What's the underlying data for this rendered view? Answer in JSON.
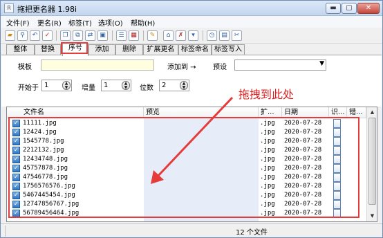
{
  "window": {
    "title": "拖把更名器 1.98i",
    "icon_glyph": "R",
    "controls": {
      "min": "▬",
      "max": "▢",
      "close": "✕"
    }
  },
  "menu": [
    "文件(F)",
    "更名(R)",
    "标签(T)",
    "选项(O)",
    "帮助(H)"
  ],
  "toolbar_icons": [
    "folder-open-icon",
    "search-icon",
    "undo-icon",
    "check-icon",
    "copy-icon",
    "paste-icon",
    "move-icon",
    "frame-icon",
    "list-icon",
    "image-icon",
    "brush-icon",
    "tag-icon",
    "clock-icon",
    "grid-icon",
    "tool-icon"
  ],
  "tabs": [
    "整体",
    "替换",
    "序号",
    "添加",
    "删除",
    "扩展更名",
    "标签命名",
    "标签写入"
  ],
  "panel": {
    "template_label": "模板",
    "template_value": "",
    "add_to_label": "添加到 →",
    "preset_label": "预设",
    "preset_value": "",
    "start_label": "开始于",
    "start_value": "1",
    "increment_label": "增量",
    "increment_value": "1",
    "digits_label": "位数",
    "digits_value": "2"
  },
  "table": {
    "columns": [
      "文件名",
      "预览",
      "扩...",
      "日期",
      "识...",
      "错..."
    ],
    "rows": [
      {
        "name": "11111.jpg",
        "ext": ".jpg",
        "date": "2020-07-28"
      },
      {
        "name": "12424.jpg",
        "ext": ".jpg",
        "date": "2020-07-28"
      },
      {
        "name": "1545778.jpg",
        "ext": ".jpg",
        "date": "2020-07-28"
      },
      {
        "name": "2212132.jpg",
        "ext": ".jpg",
        "date": "2020-07-28"
      },
      {
        "name": "12434748.jpg",
        "ext": ".jpg",
        "date": "2020-07-28"
      },
      {
        "name": "45757878.jpg",
        "ext": ".jpg",
        "date": "2020-07-28"
      },
      {
        "name": "47546778.jpg",
        "ext": ".jpg",
        "date": "2020-07-28"
      },
      {
        "name": "1756576576.jpg",
        "ext": ".jpg",
        "date": "2020-07-28"
      },
      {
        "name": "5467445454.jpg",
        "ext": ".jpg",
        "date": "2020-07-28"
      },
      {
        "name": "12747856767.jpg",
        "ext": ".jpg",
        "date": "2020-07-28"
      },
      {
        "name": "56789456464.jpg",
        "ext": ".jpg",
        "date": "2020-07-28"
      }
    ]
  },
  "status": {
    "file_count": "12 个文件"
  },
  "annotation": {
    "text": "拖拽到此处",
    "color": "#e53b3b"
  }
}
